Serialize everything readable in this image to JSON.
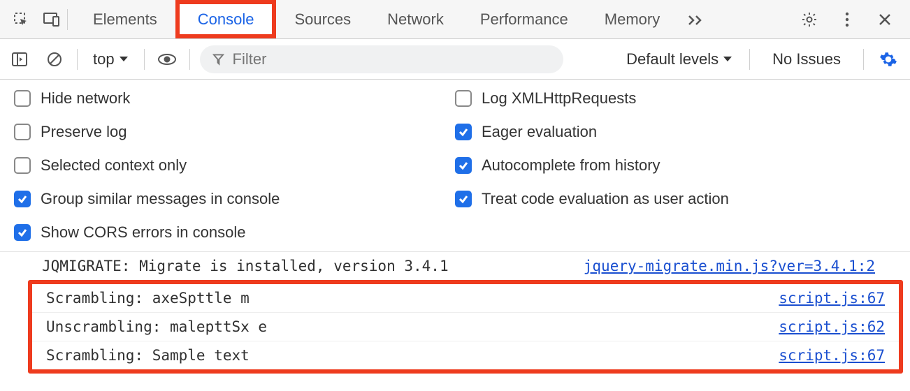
{
  "tabs": {
    "items": [
      "Elements",
      "Console",
      "Sources",
      "Network",
      "Performance",
      "Memory"
    ],
    "activeIndex": 1
  },
  "subbar": {
    "context": "top",
    "filterPlaceholder": "Filter",
    "levels": "Default levels",
    "issues": "No Issues"
  },
  "settings": {
    "left": [
      {
        "label": "Hide network",
        "checked": false
      },
      {
        "label": "Preserve log",
        "checked": false
      },
      {
        "label": "Selected context only",
        "checked": false
      },
      {
        "label": "Group similar messages in console",
        "checked": true
      },
      {
        "label": "Show CORS errors in console",
        "checked": true
      }
    ],
    "right": [
      {
        "label": "Log XMLHttpRequests",
        "checked": false
      },
      {
        "label": "Eager evaluation",
        "checked": true
      },
      {
        "label": "Autocomplete from history",
        "checked": true
      },
      {
        "label": "Treat code evaluation as user action",
        "checked": true
      }
    ]
  },
  "logs": {
    "top": [
      {
        "msg": "JQMIGRATE: Migrate is installed, version 3.4.1",
        "src": "jquery-migrate.min.js?ver=3.4.1:2"
      }
    ],
    "highlighted": [
      {
        "msg": "Scrambling: axeSpttle m",
        "src": "script.js:67"
      },
      {
        "msg": "Unscrambling: malepttSx e",
        "src": "script.js:62"
      },
      {
        "msg": "Scrambling: Sample text",
        "src": "script.js:67"
      }
    ]
  }
}
